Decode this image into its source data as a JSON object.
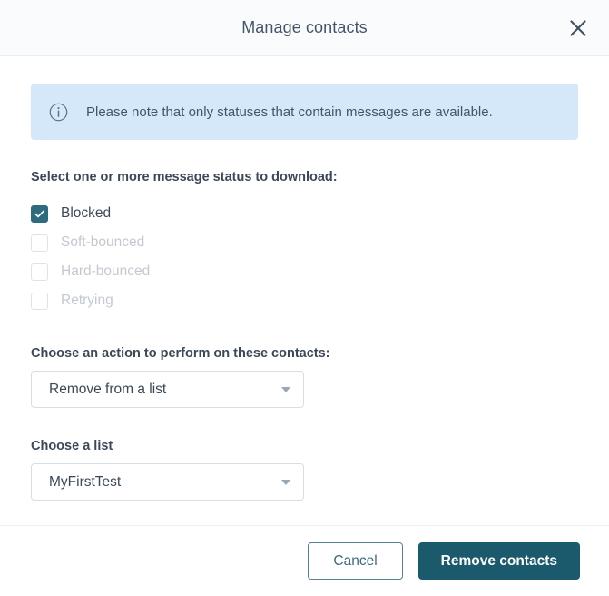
{
  "header": {
    "title": "Manage contacts",
    "close_icon": "close-icon"
  },
  "banner": {
    "icon": "info-circle-icon",
    "text": "Please note that only statuses that contain messages are available.",
    "background_color": "#d4e8f9"
  },
  "status_section": {
    "label": "Select one or more message status to download:",
    "options": [
      {
        "label": "Blocked",
        "checked": true,
        "disabled": false
      },
      {
        "label": "Soft-bounced",
        "checked": false,
        "disabled": true
      },
      {
        "label": "Hard-bounced",
        "checked": false,
        "disabled": true
      },
      {
        "label": "Retrying",
        "checked": false,
        "disabled": true
      }
    ]
  },
  "action_field": {
    "label": "Choose an action to perform on these contacts:",
    "value": "Remove from a list",
    "caret_icon": "chevron-down-icon"
  },
  "list_field": {
    "label": "Choose a list",
    "value": "MyFirstTest",
    "caret_icon": "chevron-down-icon"
  },
  "footer": {
    "cancel_label": "Cancel",
    "confirm_label": "Remove contacts"
  },
  "theme": {
    "accent": "#1a5a6c",
    "checkbox_checked": "#2d6b7e",
    "text": "#3c4858"
  }
}
